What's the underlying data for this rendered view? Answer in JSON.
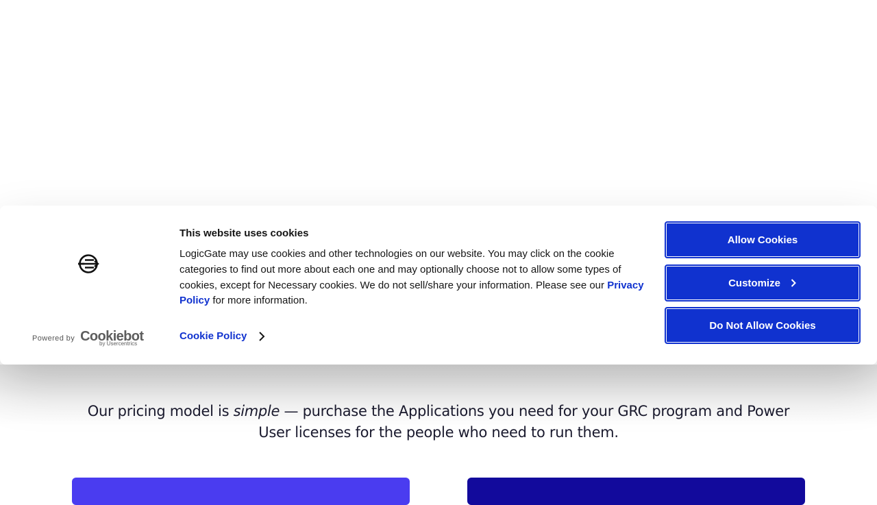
{
  "cookie_banner": {
    "title": "This website uses cookies",
    "body_before_link": "LogicGate may use cookies and other technologies on our website. You may click on the cookie categories to find out more about each one and may optionally choose not to allow some types of cookies, except for Necessary cookies.  We do not sell/share your information. Please see our ",
    "privacy_link": "Privacy Policy",
    "body_after_link": " for more information.",
    "cookie_policy_link": "Cookie Policy",
    "powered_by": "Powered by",
    "cookiebot_brand": "Cookiebot",
    "cookiebot_sub": "by Usercentrics",
    "buttons": {
      "allow": "Allow Cookies",
      "customize": "Customize",
      "deny": "Do Not Allow Cookies"
    },
    "accent_color": "#1032cf"
  },
  "page": {
    "pricing_before": "Our pricing model is ",
    "pricing_emphasis": "simple",
    "pricing_after": " — purchase the Applications you need for your GRC program and Power User licenses for the people who need to run them.",
    "card_left_color": "#4a3cf0",
    "card_right_color": "#120a9c"
  },
  "icons": {
    "brand_logo": "logicgate-logo-icon",
    "chevron": "chevron-right-icon"
  }
}
